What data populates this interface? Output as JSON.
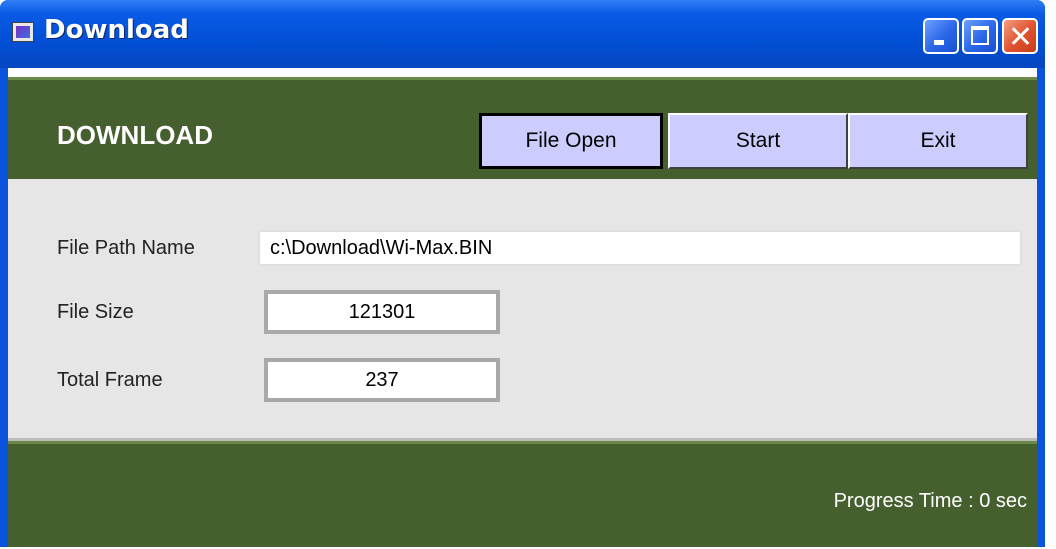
{
  "window": {
    "title": "Download",
    "icon": "app-window-icon",
    "controls": [
      "minimize-icon",
      "maximize-icon",
      "close-icon"
    ]
  },
  "header": {
    "title": "DOWNLOAD",
    "buttons": {
      "file_open": "File Open",
      "start": "Start",
      "exit": "Exit"
    },
    "background_color": "#465f2f",
    "button_color": "#ccccff"
  },
  "form": {
    "file_path_label": "File Path Name",
    "file_path_value": "c:\\Download\\Wi-Max.BIN",
    "file_size_label": "File Size",
    "file_size_value": "121301",
    "total_frame_label": "Total Frame",
    "total_frame_value": "237"
  },
  "status": {
    "progress_time": "Progress Time :  0 sec"
  }
}
